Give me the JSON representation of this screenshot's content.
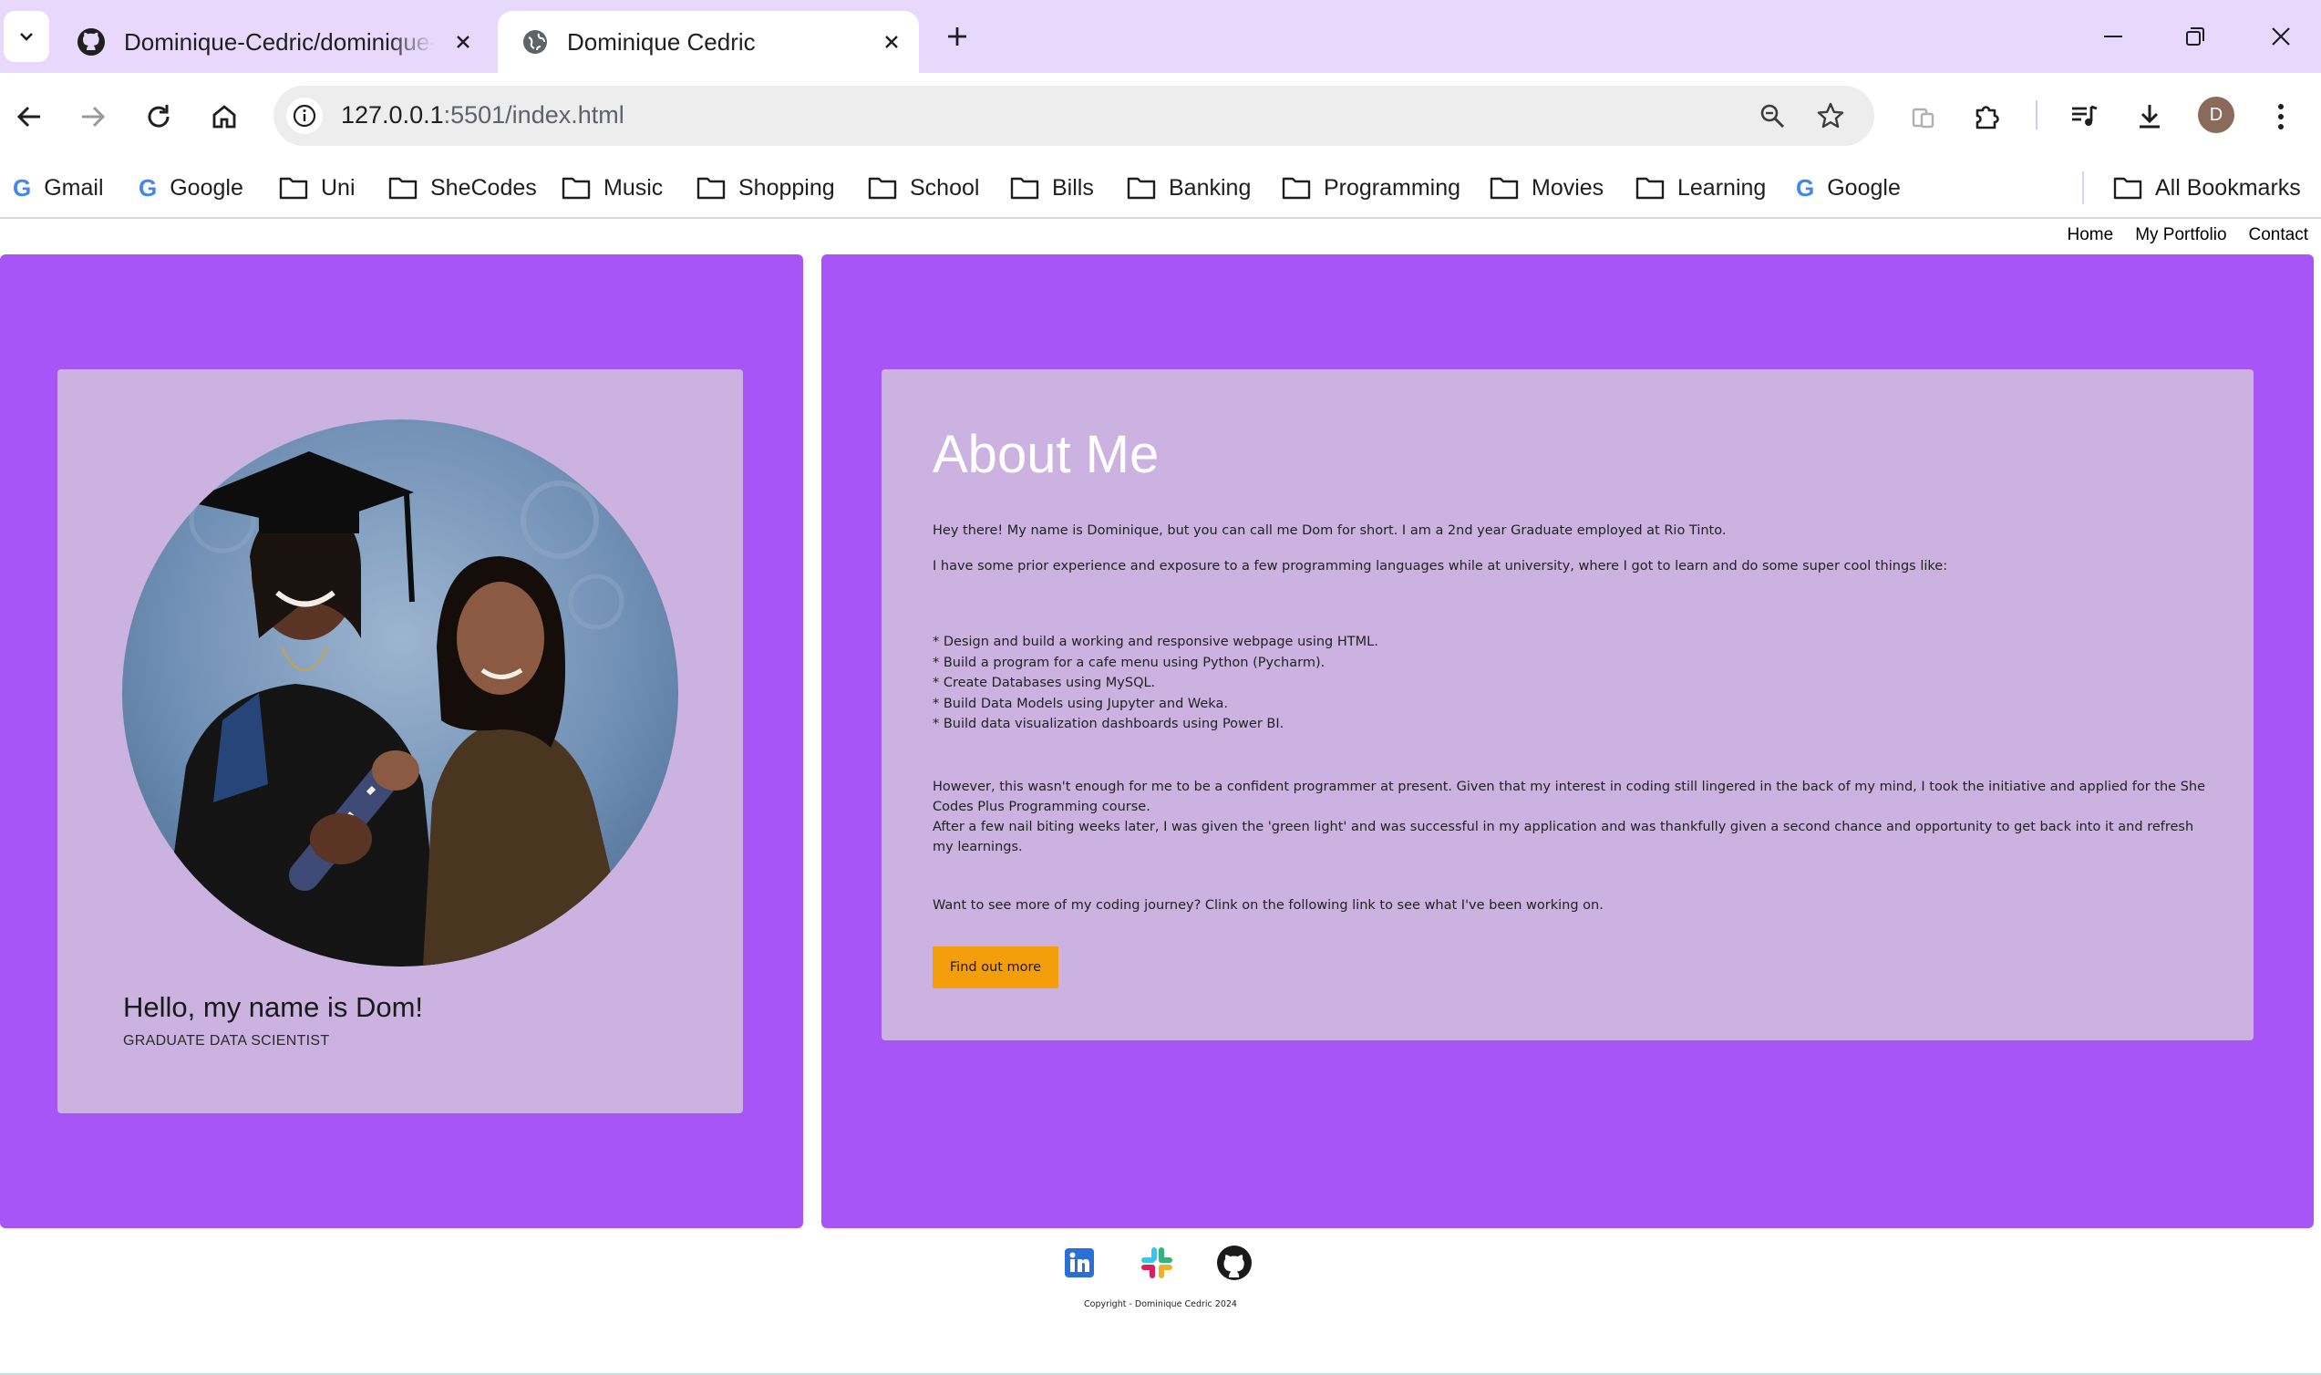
{
  "browser": {
    "tabs": [
      {
        "title": "Dominique-Cedric/dominique-cedric-portfolio",
        "icon": "github-icon",
        "active": false
      },
      {
        "title": "Dominique Cedric",
        "icon": "globe-icon",
        "active": true
      }
    ],
    "url_host": "127.0.0.1",
    "url_path": ":5501/index.html",
    "profile_initial": "D",
    "bookmarks": [
      {
        "label": "Gmail",
        "icon": "google-icon"
      },
      {
        "label": "Google",
        "icon": "google-icon"
      },
      {
        "label": "Uni",
        "icon": "folder-icon"
      },
      {
        "label": "SheCodes",
        "icon": "folder-icon"
      },
      {
        "label": "Music",
        "icon": "folder-icon"
      },
      {
        "label": "Shopping",
        "icon": "folder-icon"
      },
      {
        "label": "School",
        "icon": "folder-icon"
      },
      {
        "label": "Bills",
        "icon": "folder-icon"
      },
      {
        "label": "Banking",
        "icon": "folder-icon"
      },
      {
        "label": "Programming",
        "icon": "folder-icon"
      },
      {
        "label": "Movies",
        "icon": "folder-icon"
      },
      {
        "label": "Learning",
        "icon": "folder-icon"
      },
      {
        "label": "Google",
        "icon": "google-icon"
      }
    ],
    "all_bookmarks": "All Bookmarks"
  },
  "page": {
    "nav": [
      "Home",
      "My Portfolio",
      "Contact"
    ],
    "intro": {
      "name": "Hello, my name is Dom!",
      "role": "GRADUATE DATA SCIENTIST"
    },
    "about": {
      "title": "About Me",
      "p1": "Hey there! My name is Dominique, but you can call me Dom for short. I am a 2nd year Graduate employed at Rio Tinto.",
      "p2": "I have some prior experience and exposure to a few programming languages while at university, where I got to learn and do some super cool things like:",
      "list": [
        "* Design and build a working and responsive webpage using HTML.",
        "* Build a program for a cafe menu using Python (Pycharm).",
        "* Create Databases using MySQL.",
        "* Build Data Models using Jupyter and Weka.",
        "* Build data visualization dashboards using Power BI."
      ],
      "p3": "However, this wasn't enough for me to be a confident programmer at present. Given that my interest in coding still lingered in the back of my mind, I took the initiative and applied for the She Codes Plus Programming course.",
      "p4": "After a few nail biting weeks later, I was given the 'green light' and was successful in my application and was thankfully given a second chance and opportunity to get back into it and refresh my learnings.",
      "p5": "Want to see more of my coding journey? Clink on the following link to see what I've been working on.",
      "button": "Find out more"
    },
    "footer": {
      "icons": [
        "linkedin-icon",
        "slack-icon",
        "github-icon"
      ],
      "copyright": "Copyright - Dominique Cedric 2024"
    }
  },
  "colors": {
    "panel": "#a855f7",
    "card": "#cbb2e0",
    "button": "#f59e0b",
    "tabbar": "#e8d8fb"
  }
}
